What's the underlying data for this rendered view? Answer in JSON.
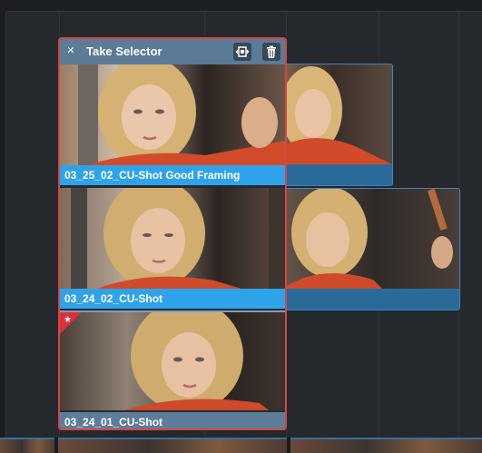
{
  "panel": {
    "title": "Take Selector",
    "close_icon": "×",
    "header_buttons": [
      "fit-clip-icon",
      "trash-icon"
    ]
  },
  "takes": [
    {
      "name": "03_25_02_CU-Shot Good Framing",
      "state": "selected"
    },
    {
      "name": "03_24_02_CU-Shot",
      "state": "selected"
    },
    {
      "name": "03_24_01_CU-Shot",
      "state": "normal",
      "flag": "★"
    }
  ],
  "colors": {
    "selection_outline": "#d64745",
    "selected_label": "#2fa3ea",
    "header": "#5b7b97",
    "flag": "#d9313a"
  }
}
